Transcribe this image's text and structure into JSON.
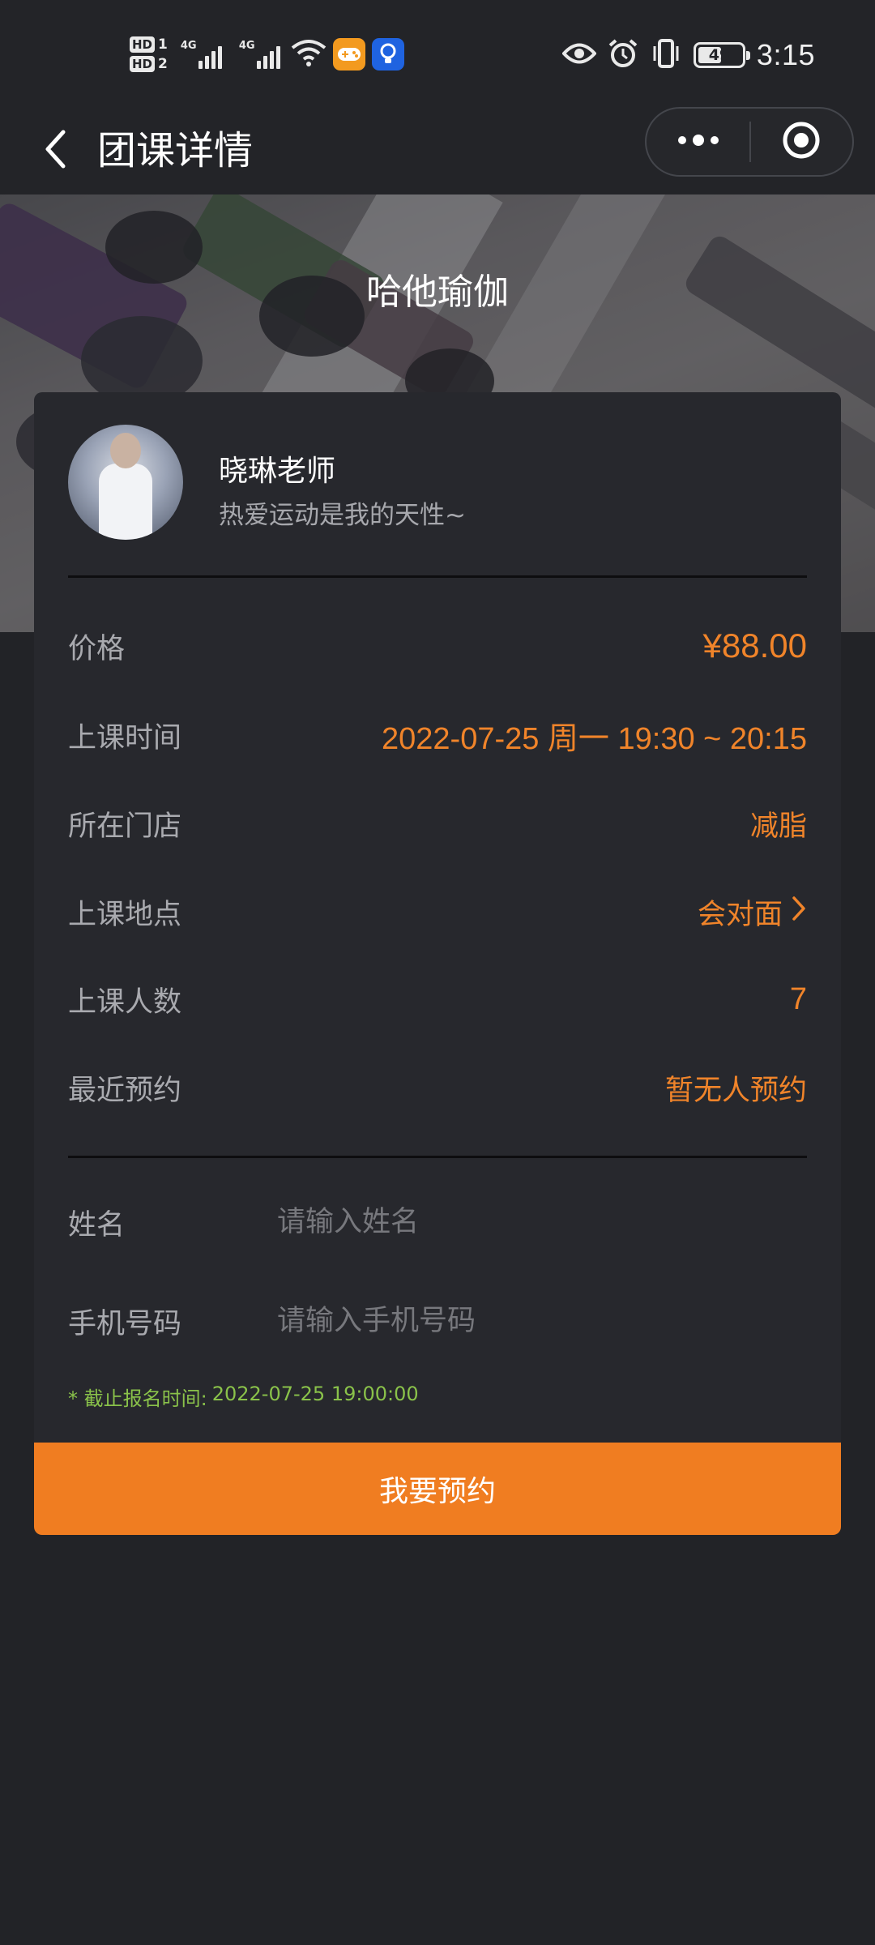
{
  "status_bar": {
    "time": "3:15",
    "battery_level": "49",
    "sim1_label": "HD",
    "sim1_slot": "1",
    "sim2_label": "HD",
    "sim2_slot": "2",
    "network_1": "4G",
    "network_2": "4G",
    "icons": [
      "hd-icon",
      "signal-icon",
      "wifi-icon",
      "game-app-icon",
      "bulb-app-icon",
      "eye-icon",
      "alarm-icon",
      "vibrate-icon",
      "battery-icon"
    ]
  },
  "nav": {
    "title": "团课详情",
    "back_icon": "chevron-left-icon",
    "more_icon": "more-dots-icon",
    "close_icon": "target-circle-icon"
  },
  "hero": {
    "title": "哈他瑜伽"
  },
  "teacher": {
    "name": "晓琳老师",
    "motto": "热爱运动是我的天性~"
  },
  "details": [
    {
      "label": "价格",
      "value": "¥88.00"
    },
    {
      "label": "上课时间",
      "value": "2022-07-25 周一 19:30 ~ 20:15"
    },
    {
      "label": "所在门店",
      "value": "减脂"
    },
    {
      "label": "上课地点",
      "value": "会对面"
    },
    {
      "label": "上课人数",
      "value": "7"
    },
    {
      "label": "最近预约",
      "value": "暂无人预约"
    }
  ],
  "form": {
    "name_label": "姓名",
    "name_placeholder": "请输入姓名",
    "name_value": "",
    "phone_label": "手机号码",
    "phone_placeholder": "请输入手机号码",
    "phone_value": ""
  },
  "deadline": {
    "label": "* 截止报名时间:",
    "value": "2022-07-25 19:00:00"
  },
  "book_button": "我要预约",
  "colors": {
    "background": "#222327",
    "card": "#27282d",
    "accent": "#f07d21",
    "deadline": "#8ac24a"
  }
}
